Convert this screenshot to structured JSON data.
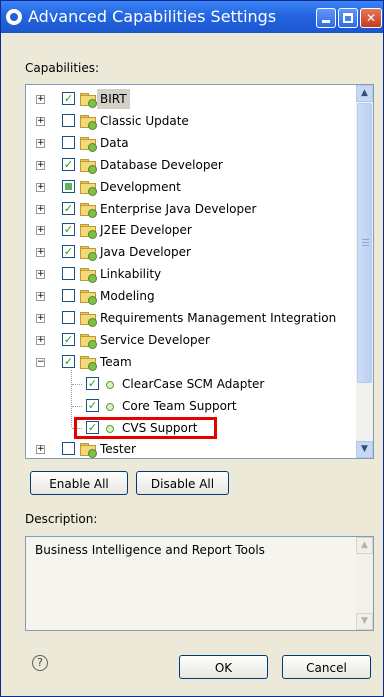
{
  "window": {
    "title": "Advanced Capabilities Settings",
    "controls": {
      "minimize": "",
      "maximize": "",
      "close": "✕"
    }
  },
  "capabilities_label": "Capabilities:",
  "tree": {
    "items": [
      {
        "label": "BIRT",
        "checked": "checked",
        "expander": "+",
        "selected": true
      },
      {
        "label": "Classic Update",
        "checked": "unchecked",
        "expander": "+"
      },
      {
        "label": "Data",
        "checked": "unchecked",
        "expander": "+"
      },
      {
        "label": "Database Developer",
        "checked": "checked",
        "expander": "+"
      },
      {
        "label": "Development",
        "checked": "partial",
        "expander": "+"
      },
      {
        "label": "Enterprise Java Developer",
        "checked": "checked",
        "expander": "+"
      },
      {
        "label": "J2EE Developer",
        "checked": "checked",
        "expander": "+"
      },
      {
        "label": "Java Developer",
        "checked": "checked",
        "expander": "+"
      },
      {
        "label": "Linkability",
        "checked": "unchecked",
        "expander": "+"
      },
      {
        "label": "Modeling",
        "checked": "unchecked",
        "expander": "+"
      },
      {
        "label": "Requirements Management Integration",
        "checked": "unchecked",
        "expander": "+"
      },
      {
        "label": "Service Developer",
        "checked": "checked",
        "expander": "+"
      },
      {
        "label": "Team",
        "checked": "checked",
        "expander": "−"
      },
      {
        "label": "ClearCase SCM Adapter",
        "checked": "checked",
        "child": true
      },
      {
        "label": "Core Team Support",
        "checked": "checked",
        "child": true
      },
      {
        "label": "CVS Support",
        "checked": "checked",
        "child": true,
        "highlighted": true
      },
      {
        "label": "Tester",
        "checked": "unchecked",
        "expander": "+"
      }
    ],
    "scroll_up": "▲",
    "scroll_down": "▼"
  },
  "buttons": {
    "enable_all": "Enable All",
    "disable_all": "Disable All",
    "ok": "OK",
    "cancel": "Cancel"
  },
  "description_label": "Description:",
  "description_text": "Business Intelligence and Report Tools",
  "help_icon": "?",
  "colors": {
    "titlebar": "#2466e0",
    "highlight_box": "#e60000",
    "check": "#21a121"
  }
}
